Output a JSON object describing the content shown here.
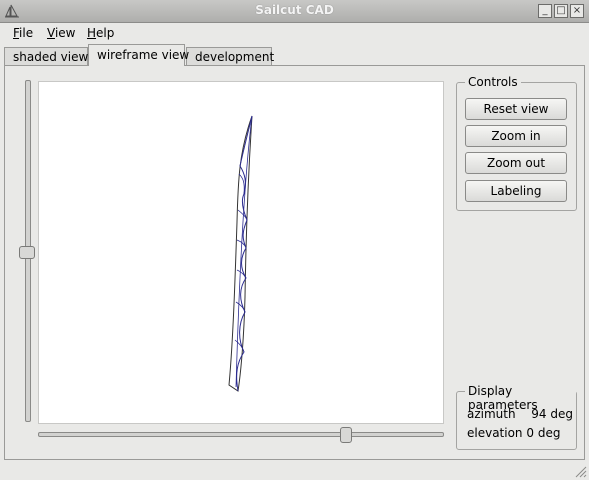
{
  "window": {
    "title": "Sailcut CAD",
    "controls": {
      "minimize": "_",
      "maximize": "□",
      "close": "×"
    }
  },
  "menubar": {
    "items": [
      {
        "label": "File",
        "mnemonic": "F",
        "rest": "ile"
      },
      {
        "label": "View",
        "mnemonic": "V",
        "rest": "iew"
      },
      {
        "label": "Help",
        "mnemonic": "H",
        "rest": "elp"
      }
    ]
  },
  "tabs": [
    {
      "label": "shaded view",
      "active": false
    },
    {
      "label": "wireframe view",
      "active": true
    },
    {
      "label": "development",
      "active": false
    }
  ],
  "controls": {
    "legend": "Controls",
    "reset_view": "Reset view",
    "zoom_in": "Zoom in",
    "zoom_out": "Zoom out",
    "labeling": "Labeling"
  },
  "display_parameters": {
    "legend": "Display parameters",
    "azimuth_label": "azimuth",
    "azimuth_value": "94 deg",
    "elevation_label": "elevation",
    "elevation_value": "0 deg",
    "azimuth_deg": 94,
    "elevation_deg": 0
  },
  "icons": {
    "app": "sail-icon",
    "resize": "resize-grip-icon"
  },
  "colors": {
    "wireframe": "#2b2b8f",
    "sail_outline": "#333333",
    "canvas_bg": "#ffffff"
  }
}
